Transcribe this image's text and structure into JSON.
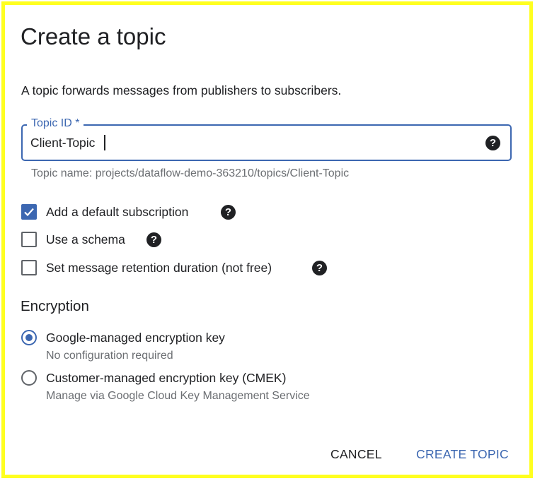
{
  "dialog": {
    "title": "Create a topic",
    "description": "A topic forwards messages from publishers to subscribers."
  },
  "topic_id": {
    "label": "Topic ID *",
    "value": "Client-Topic",
    "hint": "Topic name: projects/dataflow-demo-363210/topics/Client-Topic",
    "help_icon": "help-icon"
  },
  "options": [
    {
      "label": "Add a default subscription",
      "checked": true
    },
    {
      "label": "Use a schema",
      "checked": false
    },
    {
      "label": "Set message retention duration (not free)",
      "checked": false
    }
  ],
  "encryption": {
    "title": "Encryption",
    "choices": [
      {
        "label": "Google-managed encryption key",
        "sub": "No configuration required",
        "selected": true
      },
      {
        "label": "Customer-managed encryption key (CMEK)",
        "sub": "Manage via Google Cloud Key Management Service",
        "selected": false
      }
    ]
  },
  "actions": {
    "cancel": "CANCEL",
    "create": "CREATE TOPIC"
  },
  "colors": {
    "accent": "#3c67b1",
    "frame": "#ffff1f"
  }
}
